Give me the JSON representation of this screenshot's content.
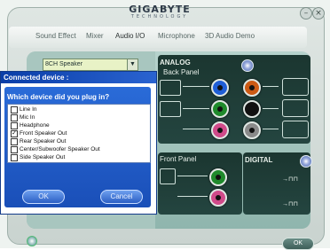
{
  "app": {
    "brand": "GIGABYTE",
    "brand_sub": "TECHNOLOGY"
  },
  "tabs": [
    {
      "label": "Sound Effect",
      "active": false
    },
    {
      "label": "Mixer",
      "active": false
    },
    {
      "label": "Audio I/O",
      "active": true
    },
    {
      "label": "Microphone",
      "active": false
    },
    {
      "label": "3D Audio Demo",
      "active": false
    }
  ],
  "speaker_select": {
    "value": "8CH Speaker"
  },
  "analog": {
    "label": "ANALOG",
    "back_panel_label": "Back Panel",
    "front_panel_label": "Front Panel"
  },
  "digital": {
    "label": "DIGITAL"
  },
  "jack_colors": {
    "blue": "#1f5ed6",
    "orange": "#cc5a14",
    "green": "#1f8a2c",
    "black": "#111111",
    "pink": "#d04a8a"
  },
  "dialog": {
    "title": "Connected device :",
    "question": "Which device did you plug in?",
    "options": [
      {
        "label": "Line In",
        "checked": false
      },
      {
        "label": "Mic In",
        "checked": false
      },
      {
        "label": "Headphone",
        "checked": false
      },
      {
        "label": "Front Speaker Out",
        "checked": true
      },
      {
        "label": "Rear Speaker Out",
        "checked": false
      },
      {
        "label": "Center/Subwoofer Speaker Out",
        "checked": false
      },
      {
        "label": "Side Speaker Out",
        "checked": false
      }
    ],
    "ok_label": "OK",
    "cancel_label": "Cancel"
  },
  "footer": {
    "ok_label": "OK"
  },
  "icons": {
    "minimize": "minimize-icon",
    "close": "close-icon",
    "settings": "settings-icon",
    "info": "info-icon"
  }
}
